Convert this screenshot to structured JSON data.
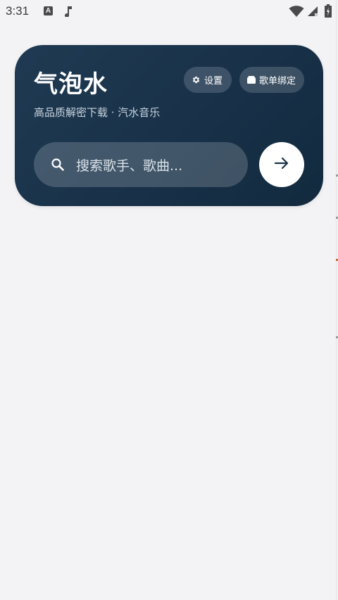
{
  "status_bar": {
    "time": "3:31",
    "a_icon": "A",
    "icons": [
      "font-a-icon",
      "music-note-icon",
      "wifi-icon",
      "signal-icon",
      "battery-charging-icon"
    ]
  },
  "hero": {
    "title": "气泡水",
    "subtitle": "高品质解密下载 · 汽水音乐",
    "settings_label": "设置",
    "bind_label": "歌单绑定",
    "search_placeholder": "搜索歌手、歌曲...",
    "go_icon": "arrow-right-icon"
  },
  "colors": {
    "background": "#f3f3f6",
    "card_gradient_start": "#1f3a52",
    "card_gradient_end": "#122a3e",
    "accent_dark": "#1b3349",
    "white": "#ffffff"
  }
}
